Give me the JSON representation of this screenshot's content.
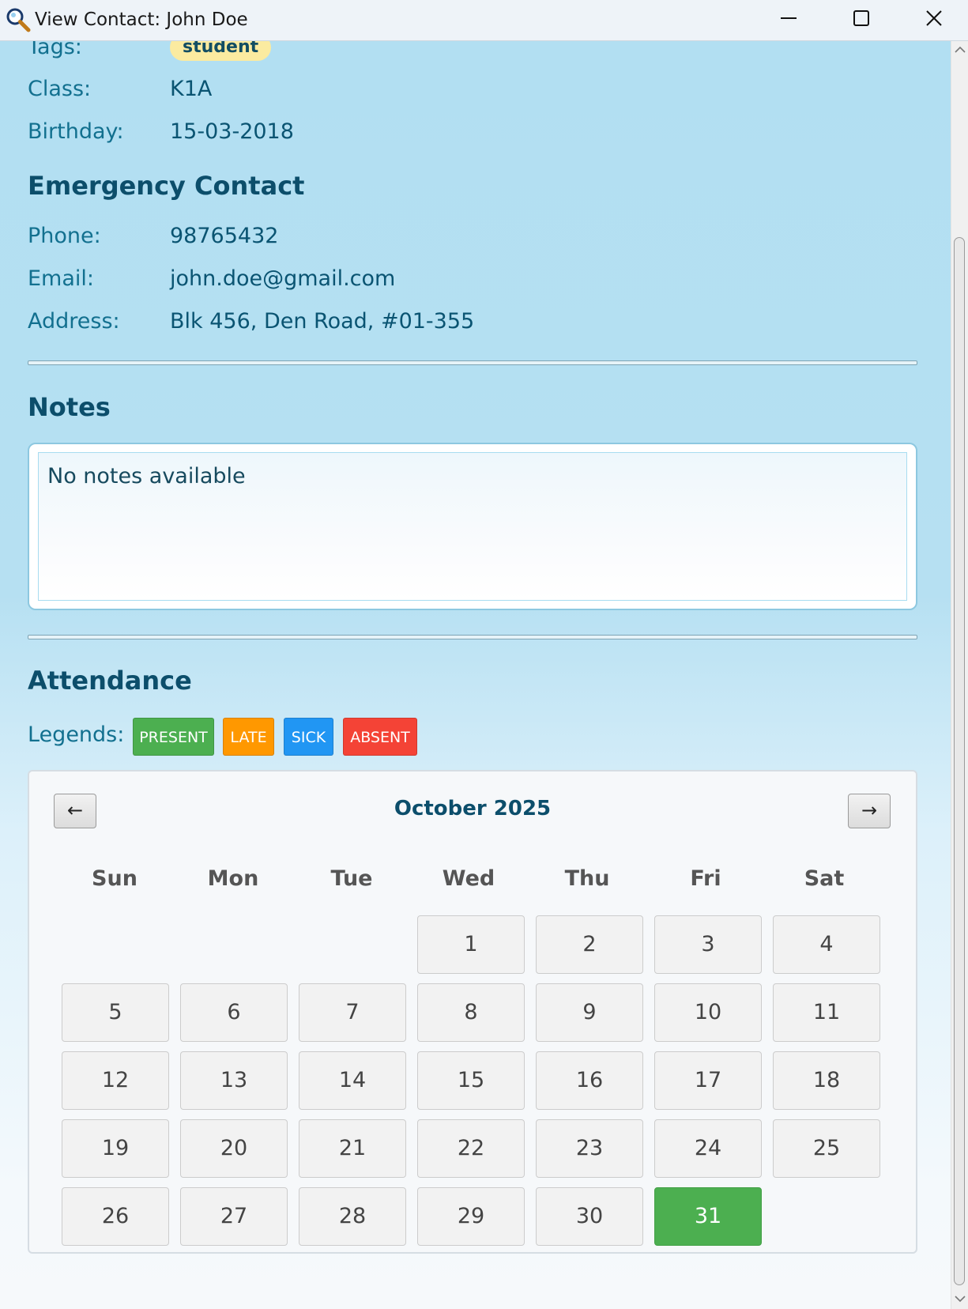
{
  "window": {
    "title": "View Contact: John Doe",
    "app_icon": "magnifier-icon",
    "controls": [
      "minimize-icon",
      "maximize-icon",
      "close-icon"
    ]
  },
  "details": {
    "tags_label": "Tags:",
    "tags": [
      "student"
    ],
    "class_label": "Class:",
    "class_value": "K1A",
    "birthday_label": "Birthday:",
    "birthday_value": "15-03-2018"
  },
  "emergency": {
    "heading": "Emergency Contact",
    "phone_label": "Phone:",
    "phone_value": "98765432",
    "email_label": "Email:",
    "email_value": "john.doe@gmail.com",
    "address_label": "Address:",
    "address_value": "Blk 456, Den Road, #01-355"
  },
  "notes": {
    "heading": "Notes",
    "text": "No notes available"
  },
  "attendance": {
    "heading": "Attendance",
    "legends_label": "Legends:",
    "legends": [
      {
        "label": "PRESENT",
        "color": "#4caf50"
      },
      {
        "label": "LATE",
        "color": "#ff9800"
      },
      {
        "label": "SICK",
        "color": "#2196f3"
      },
      {
        "label": "ABSENT",
        "color": "#f44336"
      }
    ],
    "calendar": {
      "prev_label": "←",
      "next_label": "→",
      "month_title": "October 2025",
      "weekdays": [
        "Sun",
        "Mon",
        "Tue",
        "Wed",
        "Thu",
        "Fri",
        "Sat"
      ],
      "days": [
        "1",
        "2",
        "3",
        "4",
        "5",
        "6",
        "7",
        "8",
        "9",
        "10",
        "11",
        "12",
        "13",
        "14",
        "15",
        "16",
        "17",
        "18",
        "19",
        "20",
        "21",
        "22",
        "23",
        "24",
        "25",
        "26",
        "27",
        "28",
        "29",
        "30",
        "31"
      ],
      "highlighted_day": "31",
      "highlight_status": "PRESENT"
    }
  }
}
